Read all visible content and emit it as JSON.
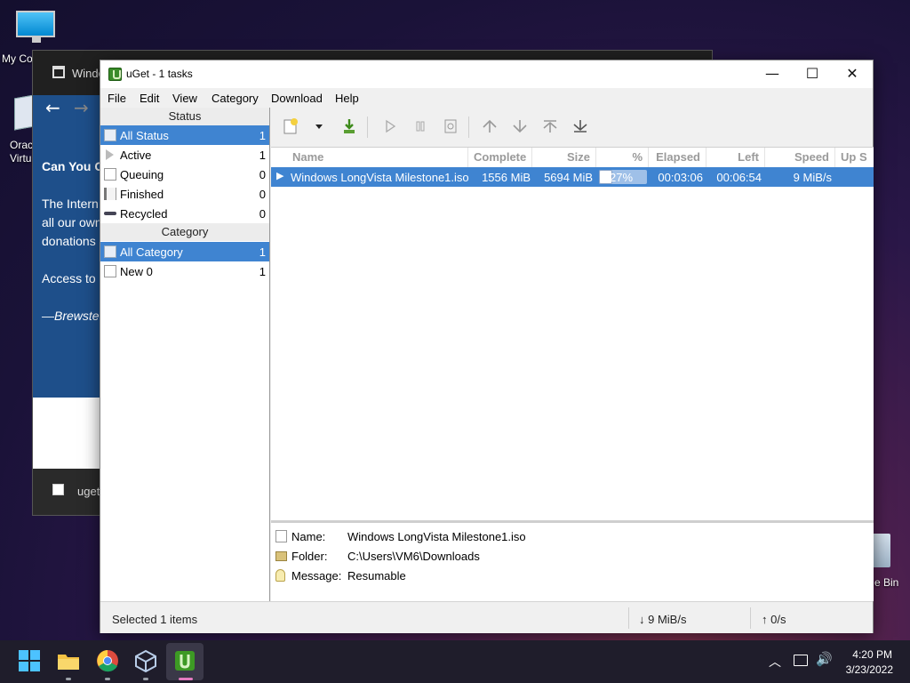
{
  "desktop": {
    "icons": [
      {
        "label": "My Co",
        "icon": "computer-icon"
      },
      {
        "label": "Orac",
        "label2": "Virtu",
        "icon": "virtualbox-icon"
      },
      {
        "label": "e Bin",
        "icon": "recycle-bin-icon"
      }
    ]
  },
  "background_window": {
    "title": "Windo",
    "page_lines": [
      "Can You C",
      "The Intern",
      "all our own",
      "donations",
      "Access to",
      "—Brewste"
    ],
    "taskbar_item": "uget"
  },
  "window": {
    "title": "uGet - 1 tasks",
    "controls": {
      "minimize": "—",
      "maximize": "☐",
      "close": "✕"
    }
  },
  "menu": [
    "File",
    "Edit",
    "View",
    "Category",
    "Download",
    "Help"
  ],
  "sidebar": {
    "status_header": "Status",
    "status_items": [
      {
        "label": "All Status",
        "count": "1",
        "icon": "all-status-icon",
        "selected": true
      },
      {
        "label": "Active",
        "count": "1",
        "icon": "play-icon",
        "selected": false
      },
      {
        "label": "Queuing",
        "count": "0",
        "icon": "queue-icon",
        "selected": false
      },
      {
        "label": "Finished",
        "count": "0",
        "icon": "finished-icon",
        "selected": false
      },
      {
        "label": "Recycled",
        "count": "0",
        "icon": "recycle-icon",
        "selected": false
      }
    ],
    "category_header": "Category",
    "category_items": [
      {
        "label": "All Category",
        "count": "1",
        "icon": "all-category-icon",
        "selected": true
      },
      {
        "label": "New 0",
        "count": "1",
        "icon": "category-icon",
        "selected": false
      }
    ]
  },
  "toolbar": {
    "buttons": [
      "new-download-icon",
      "dropdown-icon",
      "download-batch-icon",
      "start-icon",
      "pause-icon",
      "properties-icon",
      "move-up-icon",
      "move-down-icon",
      "move-top-icon",
      "move-bottom-icon"
    ]
  },
  "columns": [
    "Name",
    "Complete",
    "Size",
    "%",
    "Elapsed",
    "Left",
    "Speed",
    "Up S"
  ],
  "tasks": [
    {
      "name": "Windows LongVista Milestone1.iso",
      "complete": "1556 MiB",
      "size": "5694 MiB",
      "percent": "27%",
      "progress": 0.27,
      "elapsed": "00:03:06",
      "left": "00:06:54",
      "speed": "9 MiB/s",
      "up_speed": ""
    }
  ],
  "info": {
    "name_label": "Name:",
    "name_value": "Windows LongVista Milestone1.iso",
    "folder_label": "Folder:",
    "folder_value": "C:\\Users\\VM6\\Downloads",
    "message_label": "Message:",
    "message_value": "Resumable"
  },
  "statusbar": {
    "selected": "Selected 1 items",
    "download_speed": "↓ 9 MiB/s",
    "upload_speed": "↑ 0/s"
  },
  "taskbar": {
    "apps": [
      "start-icon",
      "file-explorer-icon",
      "chrome-icon",
      "virtualbox-icon",
      "uget-icon"
    ],
    "time": "4:20 PM",
    "date": "3/23/2022"
  },
  "colors": {
    "selection": "#3f84d1",
    "taskbar": "#1f1d2b"
  }
}
